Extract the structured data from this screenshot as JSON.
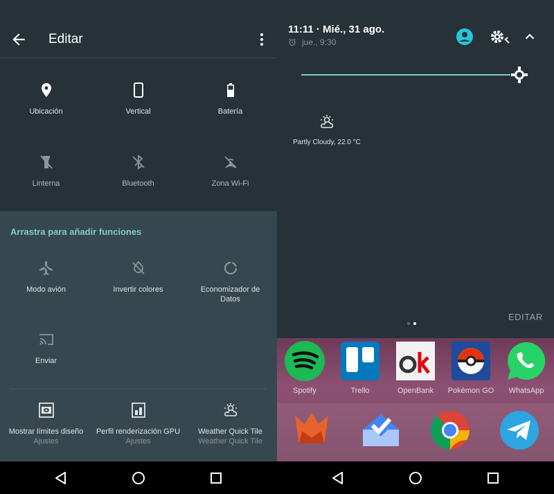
{
  "left": {
    "toolbar": {
      "title": "Editar"
    },
    "active_tiles": [
      {
        "label": "Ubicación",
        "icon": "location-icon"
      },
      {
        "label": "Vertical",
        "icon": "phone-portrait-icon"
      },
      {
        "label": "Batería",
        "icon": "battery-icon"
      },
      {
        "label": "Linterna",
        "icon": "flashlight-off-icon"
      },
      {
        "label": "Bluetooth",
        "icon": "bluetooth-off-icon"
      },
      {
        "label": "Zona Wi-Fi",
        "icon": "hotspot-off-icon"
      }
    ],
    "drag_title": "Arrastra para añadir funciones",
    "available_tiles": [
      {
        "label": "Modo avión",
        "icon": "airplane-icon"
      },
      {
        "label": "Invertir colores",
        "icon": "invert-colors-icon"
      },
      {
        "label": "Economizador de Datos",
        "icon": "data-saver-icon"
      },
      {
        "label": "Enviar",
        "icon": "cast-icon"
      }
    ],
    "third_party_tiles": [
      {
        "label": "Mostrar límites diseño",
        "sub": "Ajustes",
        "icon": "layout-bounds-icon"
      },
      {
        "label": "Perfil renderización GPU",
        "sub": "Ajustes",
        "icon": "gpu-profile-icon"
      },
      {
        "label": "Weather Quick Tile",
        "sub": "Weather Quick Tile",
        "icon": "weather-partly-cloudy-icon"
      }
    ]
  },
  "right": {
    "time": "11:11 · Mié., 31 ago.",
    "alarm": "jue., 9:30",
    "brightness_level": 0.97,
    "weather_label": "Partly Cloudy, 22.0 °C",
    "edit_label": "EDITAR",
    "apps_row1": [
      {
        "name": "Spotify",
        "color": "#1db954"
      },
      {
        "name": "Trello",
        "color": "#0079bf"
      },
      {
        "name": "OpenBank",
        "color": "#e6e6e6"
      },
      {
        "name": "Pokémon GO",
        "color": "#1e4b9c"
      },
      {
        "name": "WhatsApp",
        "color": "#25d366"
      }
    ],
    "apps_row2": [
      {
        "name": "Firefox-like",
        "color": "#e8632b"
      },
      {
        "name": "Inbox",
        "color": "#4285f4"
      },
      {
        "name": "Chrome",
        "color": "#db4437"
      },
      {
        "name": "Telegram",
        "color": "#2ca5e0"
      }
    ]
  },
  "colors": {
    "accent": "#80cbc4",
    "panel": "#263238",
    "drag_panel": "#37474f",
    "avatar": "#26c6da"
  }
}
